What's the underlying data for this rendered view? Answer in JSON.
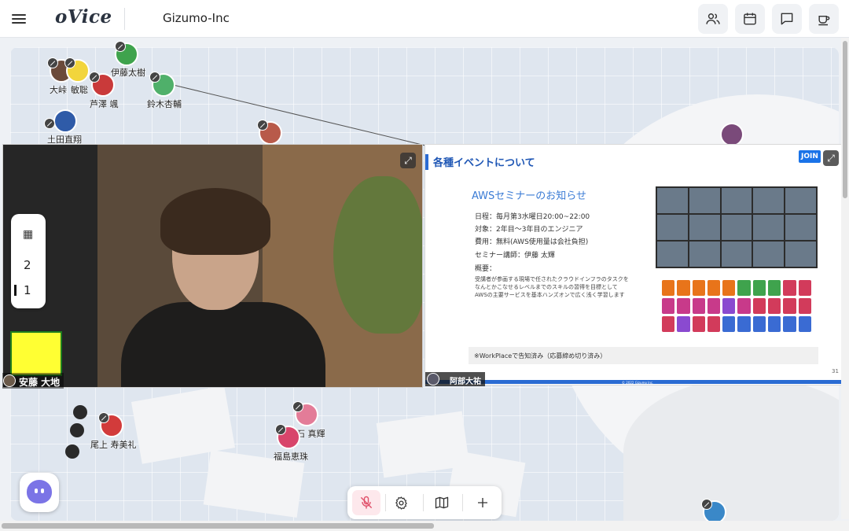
{
  "header": {
    "logo": "oVice",
    "org_name": "Gizumo-Inc",
    "buttons": [
      {
        "icon": "users-icon"
      },
      {
        "icon": "calendar-icon"
      },
      {
        "icon": "chat-icon"
      },
      {
        "icon": "coffee-icon"
      }
    ]
  },
  "users": {
    "ito": "伊藤太樹",
    "daiwa": "大峠",
    "tokisato": "敏聡",
    "ashizawa": "芦澤 颯",
    "suzuki": "鈴木杏輔",
    "tsuchida": "土田直翔",
    "onoue": "尾上 寿美礼",
    "akaishi": "赤石 真輝",
    "fukushima": "福島恵珠"
  },
  "floor_switcher": {
    "floors": [
      "2",
      "1"
    ],
    "active": "1"
  },
  "video": {
    "self_name": "安藤 大地",
    "presenter_name": "阿部大祐"
  },
  "slide": {
    "title": "各種イベントについて",
    "heading": "AWSセミナーのお知らせ",
    "lines": [
      "日程：毎月第3水曜日20:00~22:00",
      "対象：2年目〜3年目のエンジニア",
      "費用：無料(AWS使用量は会社負担)",
      "セミナー講師：伊藤 太輝",
      "概要："
    ],
    "summary": [
      "受講者が参画する現場で任されたクラウドインフラのタスクを",
      "なんとかこなせるレベルまでのスキルの習得を目標として",
      "AWSの主要サービスを基本ハンズオンで広く浅く学習します"
    ],
    "footer_note": "※WorkPlaceで告知済み（応募締め切り済み）",
    "page_number": "31",
    "copyright": "© 2022 Gizumo Inc."
  },
  "join_label": "JOIN",
  "colors": {
    "accent": "#2a6bd3",
    "mute_active": "#fde8ec",
    "self_box": "#ffff33"
  }
}
